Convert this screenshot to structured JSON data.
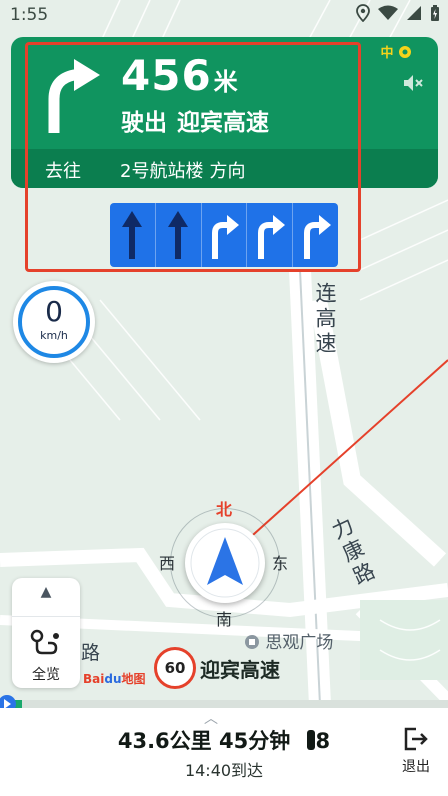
{
  "status_bar": {
    "time": "1:55"
  },
  "guidance": {
    "distance": "456",
    "distance_unit": "米",
    "action": "驶出",
    "road": "迎宾高速",
    "toward_label": "去往",
    "destination": "2号航站楼",
    "direction": "方向",
    "signal_label": "中"
  },
  "lanes": [
    "straight",
    "straight",
    "right",
    "right",
    "right"
  ],
  "speed": {
    "value": "0",
    "unit": "km/h"
  },
  "map_labels": {
    "road_a": "连高速",
    "road_b": "力康路",
    "poi": "思观广场",
    "road_c": "路"
  },
  "compass": {
    "north": "北",
    "south": "南",
    "east": "东",
    "west": "西"
  },
  "overview": {
    "label": "全览"
  },
  "speed_limit": "60",
  "current_road": "迎宾高速",
  "logo": {
    "bai": "Bai",
    "du": "du",
    "map": "地图"
  },
  "trip": {
    "distance": "43.6公里",
    "time": "45分钟",
    "lights": "8",
    "arrival": "14:40到达",
    "progress": 0.05
  },
  "exit": {
    "label": "退出"
  },
  "colors": {
    "accent_green": "#10945f",
    "lane_blue": "#1f72e8",
    "highlight_red": "#e5412b",
    "route_red": "#e5412b"
  }
}
